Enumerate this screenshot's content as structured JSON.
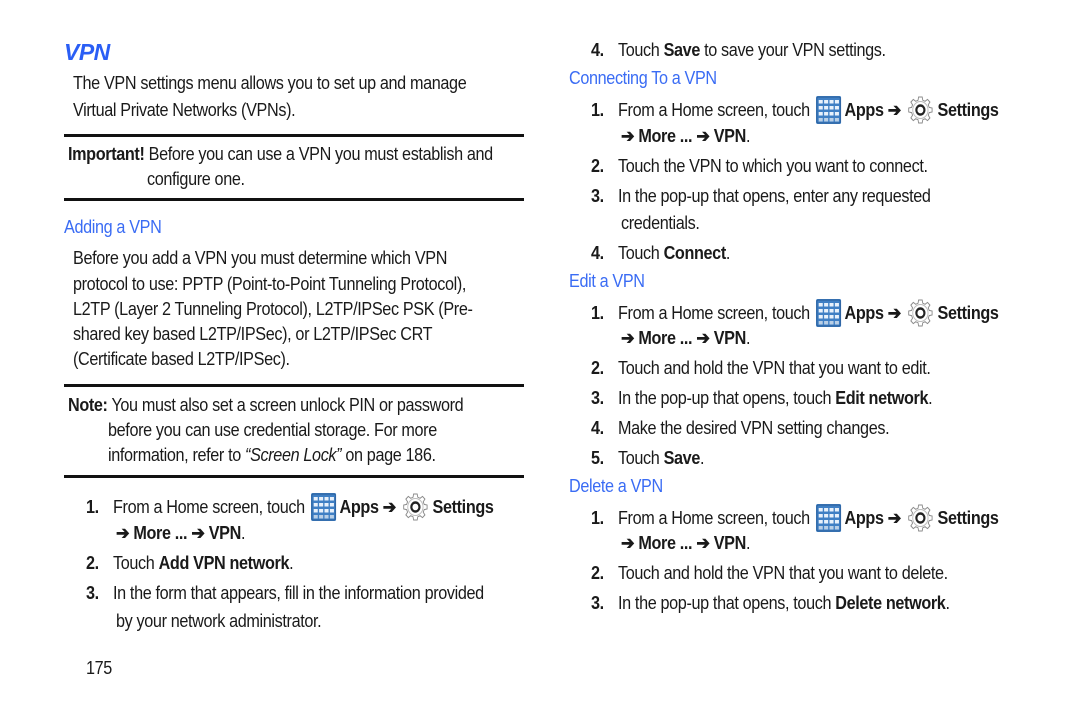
{
  "colors": {
    "heading": "#2a5ef5",
    "subheading": "#3a6cf4",
    "text": "#1a1a1a",
    "apps_icon": "#3f7fc4"
  },
  "title": "VPN",
  "intro": {
    "line1": "The VPN settings menu allows you to set up and manage",
    "line2": "Virtual Private Networks (VPNs)."
  },
  "important": {
    "label": "Important!",
    "line1": "Before you can use a VPN you must establish and",
    "line2": "configure one."
  },
  "adding": {
    "heading": "Adding a VPN",
    "lines": [
      "Before you add a VPN you must determine which VPN",
      "protocol to use: PPTP (Point-to-Point Tunneling Protocol),",
      "L2TP (Layer 2 Tunneling Protocol), L2TP/IPSec PSK (Pre-",
      "shared key based L2TP/IPSec), or L2TP/IPSec CRT",
      "(Certificate based L2TP/IPSec)."
    ]
  },
  "note": {
    "label": "Note:",
    "line1": "You must also set a screen unlock PIN or password",
    "line2": "before you can use credential storage. For more",
    "line3_pre": "information, refer to ",
    "line3_ref": "“Screen Lock”",
    "line3_post": " on page 186."
  },
  "nav_step": {
    "pre": "From a Home screen, touch",
    "apps": "Apps",
    "arrow": "➔",
    "settings": "Settings",
    "line2_arrow1": "➔",
    "more": "More ...",
    "line2_arrow2": "➔",
    "vpn": "VPN",
    "period": "."
  },
  "adding_steps": {
    "s1_num": "1.",
    "s2_num": "2.",
    "s2_pre": "Touch ",
    "s2_bold": "Add VPN network",
    "s2_post": ".",
    "s3_num": "3.",
    "s3_line1": "In the form that appears, fill in the information provided",
    "s3_line2": "by your network administrator.",
    "s4_num": "4.",
    "s4_pre": "Touch ",
    "s4_bold": "Save",
    "s4_post": " to save your VPN settings."
  },
  "connecting": {
    "heading": "Connecting To a VPN",
    "s1_num": "1.",
    "s2_num": "2.",
    "s2_text": "Touch the VPN to which you want to connect.",
    "s3_num": "3.",
    "s3_line1": "In the pop-up that opens, enter any requested",
    "s3_line2": "credentials.",
    "s4_num": "4.",
    "s4_pre": "Touch ",
    "s4_bold": "Connect",
    "s4_post": "."
  },
  "edit": {
    "heading": "Edit a VPN",
    "s1_num": "1.",
    "s2_num": "2.",
    "s2_text": "Touch and hold the VPN that you want to edit.",
    "s3_num": "3.",
    "s3_pre": "In the pop-up that opens, touch ",
    "s3_bold": "Edit network",
    "s3_post": ".",
    "s4_num": "4.",
    "s4_text": "Make the desired VPN setting changes.",
    "s5_num": "5.",
    "s5_pre": "Touch ",
    "s5_bold": "Save",
    "s5_post": "."
  },
  "delete": {
    "heading": "Delete a VPN",
    "s1_num": "1.",
    "s2_num": "2.",
    "s2_text": "Touch and hold the VPN that you want to delete.",
    "s3_num": "3.",
    "s3_pre": "In the pop-up that opens, touch ",
    "s3_bold": "Delete network",
    "s3_post": "."
  },
  "icons": {
    "apps": "apps-grid-icon",
    "settings": "settings-gear-icon"
  },
  "page_number": "175"
}
